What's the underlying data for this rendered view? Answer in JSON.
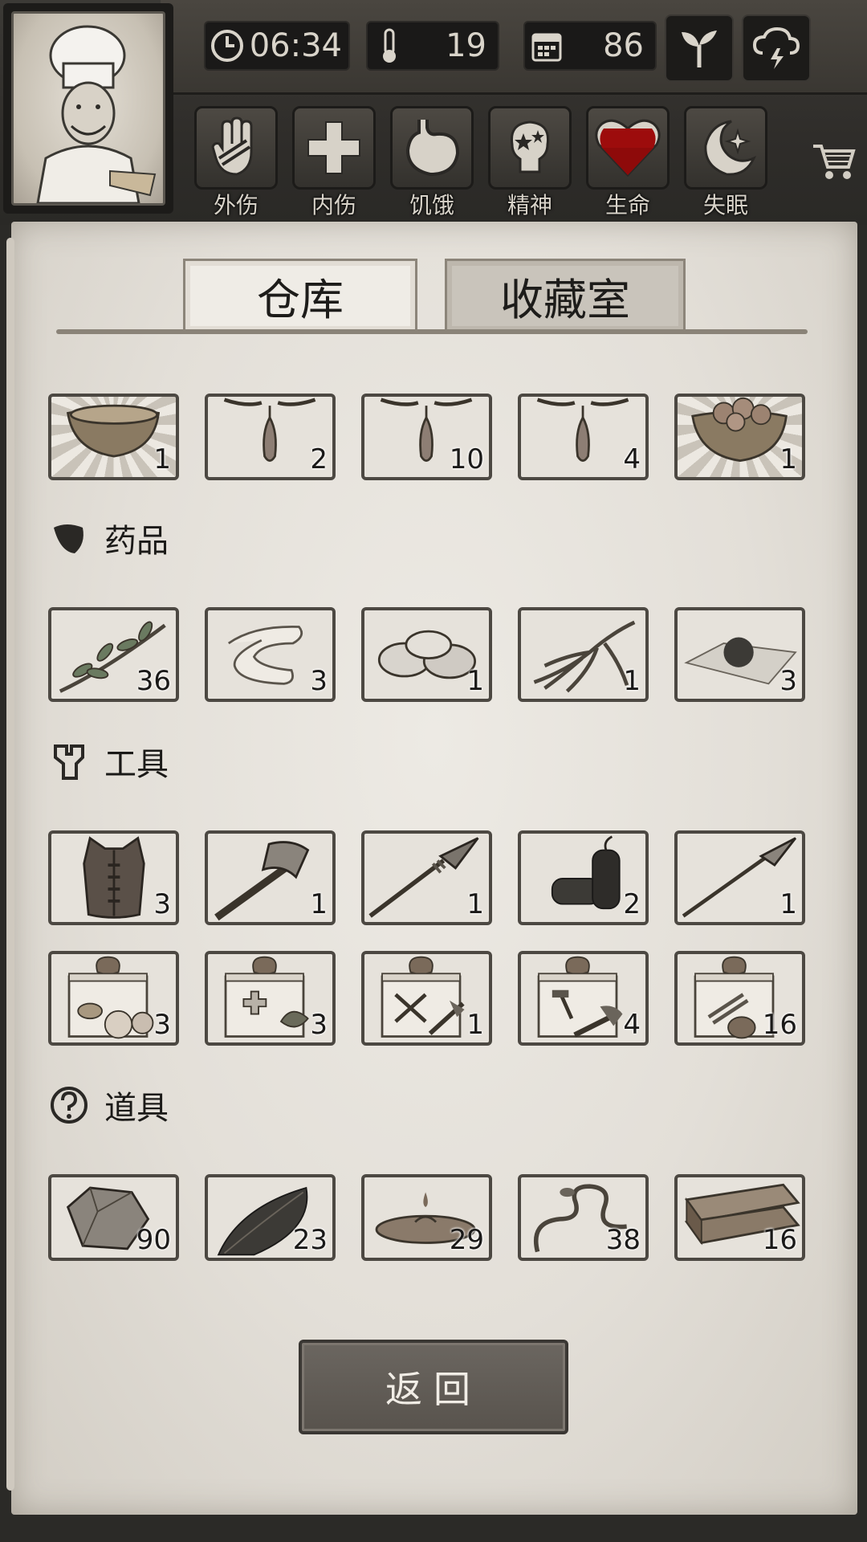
{
  "hud": {
    "time": "06:34",
    "temperature": "19",
    "days": "86"
  },
  "status": [
    {
      "label": "外伤",
      "icon": "hand-icon"
    },
    {
      "label": "内伤",
      "icon": "cross-icon"
    },
    {
      "label": "饥饿",
      "icon": "stomach-icon"
    },
    {
      "label": "精神",
      "icon": "mind-icon"
    },
    {
      "label": "生命",
      "icon": "heart-icon"
    },
    {
      "label": "失眠",
      "icon": "moon-icon"
    }
  ],
  "tabs": {
    "warehouse": "仓库",
    "collection": "收藏室"
  },
  "inventory": {
    "row0": [
      {
        "icon": "bowl-icon",
        "count": "1"
      },
      {
        "icon": "hanging-item-icon",
        "count": "2"
      },
      {
        "icon": "hanging-item-icon",
        "count": "10"
      },
      {
        "icon": "hanging-item-icon",
        "count": "4"
      },
      {
        "icon": "meat-bowl-icon",
        "count": "1"
      }
    ],
    "medicine": {
      "title": "药品",
      "items": [
        {
          "icon": "herb-branch-icon",
          "count": "36"
        },
        {
          "icon": "bandage-icon",
          "count": "3"
        },
        {
          "icon": "pills-icon",
          "count": "1"
        },
        {
          "icon": "ginseng-icon",
          "count": "1"
        },
        {
          "icon": "medicine-ball-icon",
          "count": "3"
        }
      ]
    },
    "tools": {
      "title": "工具",
      "items": [
        {
          "icon": "vest-icon",
          "count": "3"
        },
        {
          "icon": "axe-icon",
          "count": "1"
        },
        {
          "icon": "spear-icon",
          "count": "1"
        },
        {
          "icon": "dynamite-icon",
          "count": "2"
        },
        {
          "icon": "long-spear-icon",
          "count": "1"
        }
      ],
      "items2": [
        {
          "icon": "food-gift-box-icon",
          "count": "3"
        },
        {
          "icon": "medical-gift-box-icon",
          "count": "3"
        },
        {
          "icon": "weapon-gift-box-icon",
          "count": "1"
        },
        {
          "icon": "tool-gift-box-icon",
          "count": "4"
        },
        {
          "icon": "material-gift-box-icon",
          "count": "16"
        }
      ]
    },
    "props": {
      "title": "道具",
      "items": [
        {
          "icon": "stone-icon",
          "count": "90"
        },
        {
          "icon": "leaf-icon",
          "count": "23"
        },
        {
          "icon": "water-icon",
          "count": "29"
        },
        {
          "icon": "vine-icon",
          "count": "38"
        },
        {
          "icon": "wood-plank-icon",
          "count": "16"
        }
      ]
    }
  },
  "back_label": "返回"
}
